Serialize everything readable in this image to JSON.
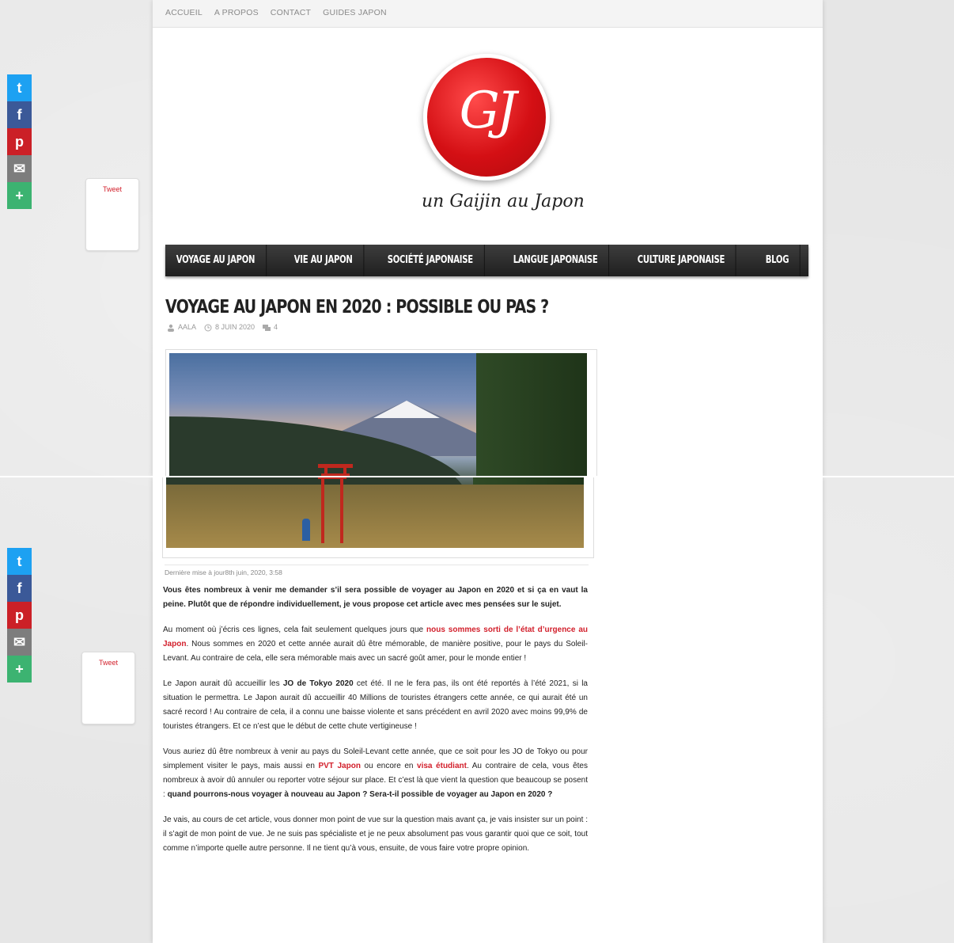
{
  "top_nav": [
    "ACCUEIL",
    "A PROPOS",
    "CONTACT",
    "GUIDES JAPON"
  ],
  "logo": {
    "monogram": "GJ",
    "wordmark": "un Gaijin au Japon"
  },
  "main_nav": [
    "VOYAGE AU JAPON",
    "VIE AU JAPON",
    "SOCIÉTÉ JAPONAISE",
    "LANGUE JAPONAISE",
    "CULTURE JAPONAISE",
    "BLOG"
  ],
  "post": {
    "title": "VOYAGE AU JAPON EN 2020 : POSSIBLE OU PAS ?",
    "author": "AALA",
    "date": "8 JUIN 2020",
    "comments": "4",
    "last_updated": "Dernière mise à jour8th juin, 2020, 3:58"
  },
  "social": {
    "tweet_label": "Tweet",
    "buttons": [
      "twitter-icon",
      "facebook-icon",
      "pinterest-icon",
      "email-icon",
      "more-icon"
    ]
  },
  "colors": {
    "brand_red": "#d21f2b",
    "nav_dark": "#2a2a2a"
  },
  "article": {
    "p1": "Vous êtes nombreux à venir me demander s’il sera possible de voyager au Japon en 2020 et si ça en vaut la peine. Plutôt que de répondre individuellement, je vous propose cet article avec mes pensées sur le sujet.",
    "p2_a": "Au moment où j’écris ces lignes, cela fait seulement quelques jours que ",
    "p2_link": "nous sommes sorti de l’état d’urgence au Japon",
    "p2_b": ". Nous sommes en 2020 et cette année aurait dû être mémorable, de manière positive, pour le pays du Soleil-Levant. Au contraire de cela, elle sera mémorable mais avec un sacré goût amer, pour le monde entier !",
    "p3_a": "Le Japon aurait dû accueillir les ",
    "p3_bold": "JO de Tokyo 2020",
    "p3_b": " cet été. Il ne le fera pas, ils ont été reportés à l’été 2021, si la situation le permettra. Le Japon aurait dû accueillir 40 Millions de touristes étrangers cette année, ce qui aurait été un sacré record ! Au contraire de cela, il a connu une baisse violente et sans précédent en avril 2020 avec moins 99,9% de touristes étrangers. Et ce n’est que le début de cette chute vertigineuse !",
    "p4_a": "Vous auriez dû être nombreux à venir au pays du Soleil-Levant cette année, que ce soit pour les JO de Tokyo ou pour simplement visiter le pays, mais aussi en ",
    "p4_link1": "PVT Japon",
    "p4_b": " ou encore en ",
    "p4_link2": "visa étudiant",
    "p4_c": ". Au contraire de cela, vous êtes nombreux à avoir dû annuler ou reporter votre séjour sur place. Et c’est là que vient la question que beaucoup se posent : ",
    "p4_bold": "quand pourrons-nous voyager à nouveau au Japon ? Sera-t-il possible de voyager au Japon en 2020 ?",
    "p5": "Je vais, au cours de cet article, vous donner mon point de vue sur la question mais avant ça, je vais insister sur un point : il s’agit de mon point de vue. Je ne suis pas spécialiste et je ne peux absolument pas vous garantir quoi que ce soit, tout comme n’importe quelle autre personne. Il ne tient qu’à vous, ensuite, de vous faire votre propre opinion."
  }
}
